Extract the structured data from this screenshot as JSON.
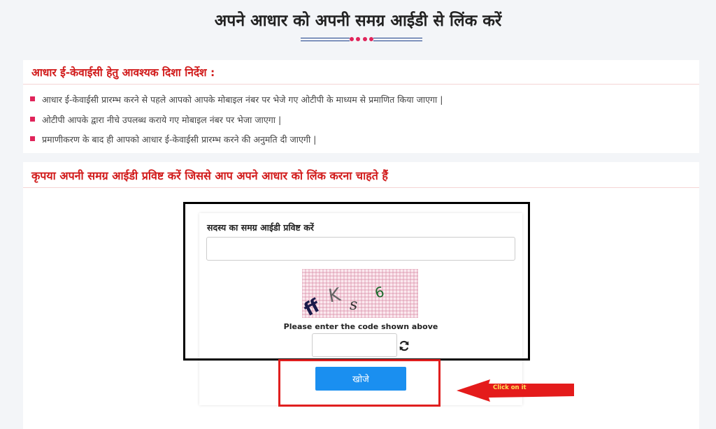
{
  "page": {
    "title": "अपने आधार को अपनी समग्र आईडी से लिंक करें"
  },
  "guidelines": {
    "heading": "आधार ई-केवाईसी हेतु आवश्यक दिशा निर्देश :",
    "items": [
      "आधार ई-केवाईसी प्रारम्भ करने से पहले आपको आपके मोबाइल नंबर पर भेजे गए ओटीपी के माध्यम से प्रमाणित किया जाएगा |",
      "ओटीपी आपके द्वारा नीचे उपलब्ध कराये गए मोबाइल नंबर पर भेजा जाएगा |",
      "प्रमाणीकरण के बाद ही आपको आधार ई-केवाईसी प्रारम्भ करने की अनुमति दी जाएगी |"
    ]
  },
  "form": {
    "heading": "कृपया अपनी समग्र आईडी प्रविष्ट करें जिससे आप अपने आधार को लिंक करना चाहते हैं",
    "id_label": "सदस्य का समग्र आईडी प्रविष्ट करें",
    "id_value": "",
    "captcha_chars": [
      "ff",
      "K",
      "s",
      "6"
    ],
    "captcha_label": "Please enter the code shown above",
    "captcha_value": "",
    "submit_label": "खोजे"
  },
  "annotation": {
    "text": "Click on it"
  },
  "colors": {
    "accent_red": "#d11a1a",
    "bullet": "#e0245a",
    "button_blue": "#1a8ff0",
    "ornament_blue": "#1c3f8a"
  },
  "icons": {
    "refresh": "refresh-icon",
    "arrow": "left-arrow-annotation"
  }
}
